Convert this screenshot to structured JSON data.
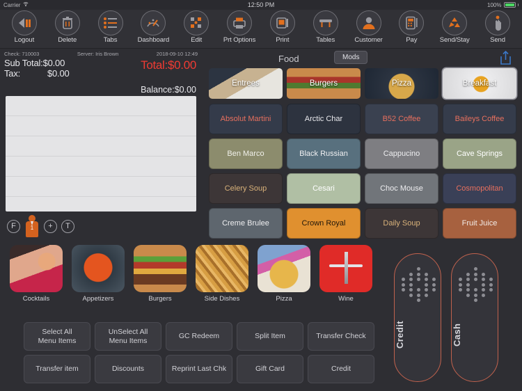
{
  "statusbar": {
    "carrier": "Carrier",
    "time": "12:50 PM",
    "battery": "100%"
  },
  "toolbar": {
    "items": [
      {
        "label": "Logout",
        "icon": "logout-icon"
      },
      {
        "label": "Delete",
        "icon": "trash-icon"
      },
      {
        "label": "Tabs",
        "icon": "list-icon"
      },
      {
        "label": "Dashboard",
        "icon": "gauge-icon"
      },
      {
        "label": "Edit",
        "icon": "edit-blocks-icon"
      },
      {
        "label": "Prt Options",
        "icon": "printer-options-icon"
      },
      {
        "label": "Print",
        "icon": "printer-icon"
      },
      {
        "label": "Tables",
        "icon": "table-icon"
      },
      {
        "label": "Customer",
        "icon": "person-icon"
      },
      {
        "label": "Pay",
        "icon": "calculator-icon"
      },
      {
        "label": "Send/Stay",
        "icon": "recycle-icon"
      },
      {
        "label": "Send",
        "icon": "hand-tap-icon"
      }
    ]
  },
  "check": {
    "check_label": "Check: 710003",
    "server_label": "Server: Iris Brown",
    "datetime": "2018-09-10 12:49",
    "subtotal_label": "Sub Total:$0.00",
    "tax_label": "Tax:",
    "tax_value": "$0.00",
    "total_label": "Total:$0.00",
    "total_color": "#ef3b33",
    "balance_label": "Balance:$0.00"
  },
  "guest_controls": {
    "fire_label": "F",
    "guest_count": "1",
    "add_label": "+",
    "transfer_label": "T"
  },
  "categories": [
    {
      "label": "Cocktails",
      "image": "cocktail-photo"
    },
    {
      "label": "Appetizers",
      "image": "soup-photo"
    },
    {
      "label": "Burgers",
      "image": "burger-photo"
    },
    {
      "label": "Side Dishes",
      "image": "fries-photo"
    },
    {
      "label": "Pizza",
      "image": "pizza-photo"
    },
    {
      "label": "Wine",
      "image": "corkscrew-photo"
    }
  ],
  "actions": {
    "row1": [
      "Select All\nMenu Items",
      "UnSelect All\nMenu Items",
      "GC Redeem",
      "Split Item",
      "Transfer Check"
    ],
    "row2": [
      "Transfer item",
      "Discounts",
      "Reprint Last Chk",
      "Gift Card",
      "Credit"
    ]
  },
  "payment": {
    "credit_label": "Credit",
    "cash_label": "Cash",
    "border_color": "#c1624d"
  },
  "right_panel": {
    "title": "Food",
    "mods_label": "Mods",
    "share_icon": "share-icon",
    "share_color": "#3b78c8",
    "tabs": [
      {
        "label": "Entrees",
        "selected": false
      },
      {
        "label": "Burgers",
        "selected": false
      },
      {
        "label": "Pizza",
        "selected": false
      },
      {
        "label": "Breakfast",
        "selected": true
      }
    ],
    "menu_items": [
      {
        "label": "Absolut Martini",
        "bg": "#343b4a",
        "fg": "#e8705e"
      },
      {
        "label": "Arctic Char",
        "bg": "#2d333f",
        "fg": "#e9e9ed"
      },
      {
        "label": "B52 Coffee",
        "bg": "#3a4150",
        "fg": "#e8705e"
      },
      {
        "label": "Baileys Coffee",
        "bg": "#353c4b",
        "fg": "#e8705e"
      },
      {
        "label": "Ben Marco",
        "bg": "#8c8c6d",
        "fg": "#f0f0ea"
      },
      {
        "label": "Black Russian",
        "bg": "#58707e",
        "fg": "#f0f0f2"
      },
      {
        "label": "Cappucino",
        "bg": "#7e7e82",
        "fg": "#eeeef0"
      },
      {
        "label": "Cave Springs",
        "bg": "#9aa487",
        "fg": "#ffffff"
      },
      {
        "label": "Celery Soup",
        "bg": "#3d3637",
        "fg": "#d9b27a"
      },
      {
        "label": "Cesari",
        "bg": "#b0bfa4",
        "fg": "#ffffff"
      },
      {
        "label": "Choc Mouse",
        "bg": "#71757a",
        "fg": "#ededef"
      },
      {
        "label": "Cosmopolitan",
        "bg": "#3a4057",
        "fg": "#e8705e"
      },
      {
        "label": "Creme Brulee",
        "bg": "#5e666e",
        "fg": "#eeeef0"
      },
      {
        "label": "Crown Royal",
        "bg": "#e0902f",
        "fg": "#20160a"
      },
      {
        "label": "Daily Soup",
        "bg": "#3d3637",
        "fg": "#d9b27a"
      },
      {
        "label": "Fruit Juice",
        "bg": "#a7613f",
        "fg": "#f3ece8"
      }
    ]
  }
}
